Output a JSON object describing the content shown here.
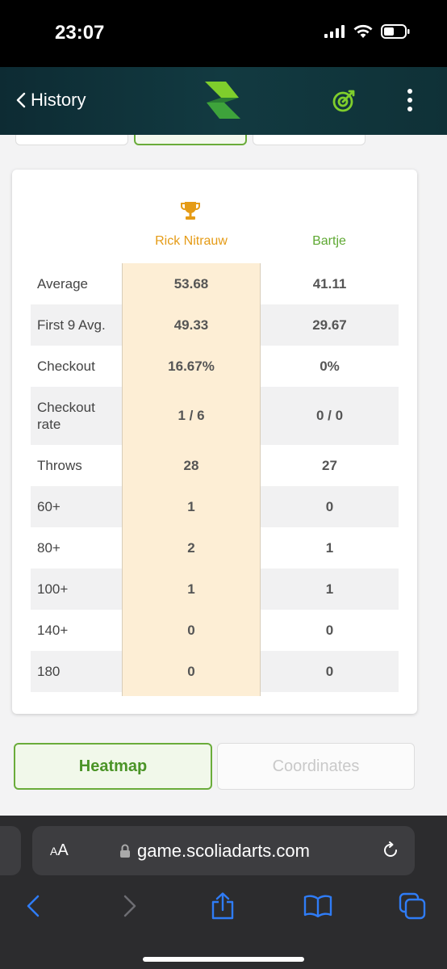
{
  "status_bar": {
    "time": "23:07"
  },
  "header": {
    "back_label": "History"
  },
  "players": {
    "player1": {
      "name": "Rick Nitrauw",
      "color": "#e59b16"
    },
    "player2": {
      "name": "Bartje",
      "color": "#5ea832"
    }
  },
  "stats": [
    {
      "label": "Average",
      "p1": "53.68",
      "p2": "41.11"
    },
    {
      "label": "First 9 Avg.",
      "p1": "49.33",
      "p2": "29.67"
    },
    {
      "label": "Checkout",
      "p1": "16.67%",
      "p2": "0%"
    },
    {
      "label": "Checkout rate",
      "p1": "1 / 6",
      "p2": "0 / 0"
    },
    {
      "label": "Throws",
      "p1": "28",
      "p2": "27"
    },
    {
      "label": "60+",
      "p1": "1",
      "p2": "0"
    },
    {
      "label": "80+",
      "p1": "2",
      "p2": "1"
    },
    {
      "label": "100+",
      "p1": "1",
      "p2": "1"
    },
    {
      "label": "140+",
      "p1": "0",
      "p2": "0"
    },
    {
      "label": "180",
      "p1": "0",
      "p2": "0"
    }
  ],
  "buttons": {
    "heatmap": "Heatmap",
    "coordinates": "Coordinates"
  },
  "browser": {
    "aa_small": "A",
    "aa_large": "A",
    "url": "game.scoliadarts.com"
  },
  "colors": {
    "accent_green": "#6aac3a",
    "highlight_column": "#fdeed5",
    "header_bg": "#123a41"
  }
}
